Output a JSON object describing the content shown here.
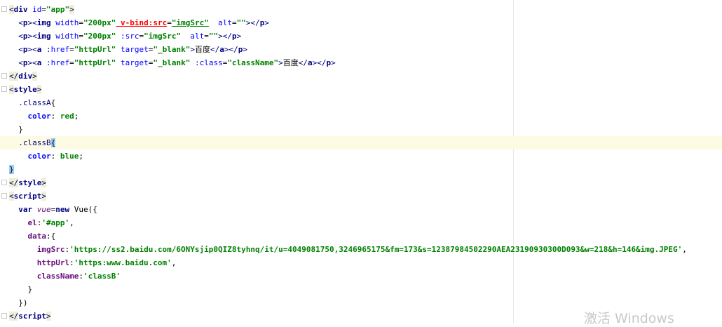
{
  "editor": {
    "lines": [
      {
        "tokens": [
          [
            "t-ptag tagbox",
            "<"
          ],
          [
            "t-tag",
            "div"
          ],
          [
            "t-attr",
            " id"
          ],
          [
            "t-punct",
            "="
          ],
          [
            "t-val",
            "\"app\""
          ],
          [
            "t-ptag tagbox",
            ">"
          ]
        ]
      },
      {
        "tokens": [
          [
            "t-ptag",
            "  <"
          ],
          [
            "t-tag",
            "p"
          ],
          [
            "t-ptag",
            "><"
          ],
          [
            "t-tag",
            "img"
          ],
          [
            "t-attr",
            " width"
          ],
          [
            "t-punct",
            "="
          ],
          [
            "t-val",
            "\"200px\""
          ],
          [
            "t-err",
            " v-bind"
          ],
          [
            "t-err",
            ":src"
          ],
          [
            "t-punct",
            "="
          ],
          [
            "t-val t-under",
            "\"imgSrc\""
          ],
          [
            "t-attr",
            "  alt"
          ],
          [
            "t-punct",
            "="
          ],
          [
            "t-val",
            "\"\""
          ],
          [
            "t-ptag",
            "></"
          ],
          [
            "t-tag",
            "p"
          ],
          [
            "t-ptag",
            ">"
          ]
        ]
      },
      {
        "tokens": [
          [
            "t-ptag",
            "  <"
          ],
          [
            "t-tag",
            "p"
          ],
          [
            "t-ptag",
            "><"
          ],
          [
            "t-tag",
            "img"
          ],
          [
            "t-attr",
            " width"
          ],
          [
            "t-punct",
            "="
          ],
          [
            "t-val",
            "\"200px\""
          ],
          [
            "t-attr",
            " :src"
          ],
          [
            "t-punct",
            "="
          ],
          [
            "t-val",
            "\"imgSrc\""
          ],
          [
            "t-attr",
            "  alt"
          ],
          [
            "t-punct",
            "="
          ],
          [
            "t-val",
            "\"\""
          ],
          [
            "t-ptag",
            "></"
          ],
          [
            "t-tag",
            "p"
          ],
          [
            "t-ptag",
            ">"
          ]
        ]
      },
      {
        "tokens": [
          [
            "t-ptag",
            "  <"
          ],
          [
            "t-tag",
            "p"
          ],
          [
            "t-ptag",
            "><"
          ],
          [
            "t-tag",
            "a"
          ],
          [
            "t-attr",
            " :href"
          ],
          [
            "t-punct",
            "="
          ],
          [
            "t-val",
            "\"httpUrl\""
          ],
          [
            "t-attr",
            " target"
          ],
          [
            "t-punct",
            "="
          ],
          [
            "t-val",
            "\"_blank\""
          ],
          [
            "t-ptag",
            ">"
          ],
          [
            "t-txt",
            "百度"
          ],
          [
            "t-ptag",
            "</"
          ],
          [
            "t-tag",
            "a"
          ],
          [
            "t-ptag",
            "></"
          ],
          [
            "t-tag",
            "p"
          ],
          [
            "t-ptag",
            ">"
          ]
        ]
      },
      {
        "tokens": [
          [
            "t-ptag",
            "  <"
          ],
          [
            "t-tag",
            "p"
          ],
          [
            "t-ptag",
            "><"
          ],
          [
            "t-tag",
            "a"
          ],
          [
            "t-attr",
            " :href"
          ],
          [
            "t-punct",
            "="
          ],
          [
            "t-val",
            "\"httpUrl\""
          ],
          [
            "t-attr",
            " target"
          ],
          [
            "t-punct",
            "="
          ],
          [
            "t-val",
            "\"_blank\""
          ],
          [
            "t-attr",
            " :class"
          ],
          [
            "t-punct",
            "="
          ],
          [
            "t-val",
            "\"className\""
          ],
          [
            "t-ptag",
            ">"
          ],
          [
            "t-txt",
            "百度"
          ],
          [
            "t-ptag",
            "</"
          ],
          [
            "t-tag",
            "a"
          ],
          [
            "t-ptag",
            "></"
          ],
          [
            "t-tag",
            "p"
          ],
          [
            "t-ptag",
            ">"
          ]
        ]
      },
      {
        "tokens": [
          [
            "t-ptag tagbox",
            "</"
          ],
          [
            "t-tag",
            "div"
          ],
          [
            "t-ptag tagbox",
            ">"
          ]
        ]
      },
      {
        "tokens": [
          [
            "t-ptag tagbox",
            "<"
          ],
          [
            "t-tag",
            "style"
          ],
          [
            "t-ptag tagbox",
            ">"
          ]
        ]
      },
      {
        "tokens": [
          [
            "t-sel",
            "  .classA"
          ],
          [
            "t-punct",
            "{"
          ]
        ]
      },
      {
        "tokens": [
          [
            "t-cssprop",
            "    color"
          ],
          [
            "t-punct",
            ": "
          ],
          [
            "t-cssval",
            "red"
          ],
          [
            "t-punct",
            ";"
          ]
        ]
      },
      {
        "tokens": [
          [
            "t-punct",
            "  }"
          ]
        ]
      },
      {
        "tokens": [
          [
            "t-sel",
            "  .classB"
          ],
          [
            "t-punct brace-hl",
            "{"
          ]
        ],
        "highlight": true
      },
      {
        "tokens": [
          [
            "t-cssprop",
            "    color"
          ],
          [
            "t-punct",
            ": "
          ],
          [
            "t-cssval",
            "blue"
          ],
          [
            "t-punct",
            ";"
          ]
        ]
      },
      {
        "tokens": [
          [
            "t-punct brace-hl",
            "}"
          ]
        ]
      },
      {
        "tokens": [
          [
            "t-ptag tagbox",
            "</"
          ],
          [
            "t-tag",
            "style"
          ],
          [
            "t-ptag tagbox",
            ">"
          ]
        ]
      },
      {
        "tokens": [
          [
            "t-ptag tagbox",
            "<"
          ],
          [
            "t-tag",
            "script"
          ],
          [
            "t-ptag tagbox",
            ">"
          ]
        ]
      },
      {
        "tokens": [
          [
            "t-kw",
            "  var "
          ],
          [
            "t-var",
            "vue"
          ],
          [
            "t-punct",
            "="
          ],
          [
            "t-kw",
            "new "
          ],
          [
            "t-punct",
            "Vue({"
          ]
        ]
      },
      {
        "tokens": [
          [
            "t-prop",
            "    el"
          ],
          [
            "t-punct",
            ":"
          ],
          [
            "t-str",
            "'#app'"
          ],
          [
            "t-punct",
            ","
          ]
        ]
      },
      {
        "tokens": [
          [
            "t-prop",
            "    data"
          ],
          [
            "t-punct",
            ":{"
          ]
        ]
      },
      {
        "tokens": [
          [
            "t-prop",
            "      imgSrc"
          ],
          [
            "t-punct",
            ":"
          ],
          [
            "t-str",
            "'https://ss2.baidu.com/6ONYsjip0QIZ8tyhnq/it/u=4049081750,3246965175&fm=173&s=12387984502290AEA23190930300D093&w=218&h=146&img.JPEG'"
          ],
          [
            "t-punct",
            ","
          ]
        ]
      },
      {
        "tokens": [
          [
            "t-prop",
            "      httpUrl"
          ],
          [
            "t-punct",
            ":"
          ],
          [
            "t-str",
            "'https:www.baidu.com'"
          ],
          [
            "t-punct",
            ","
          ]
        ]
      },
      {
        "tokens": [
          [
            "t-prop",
            "      className"
          ],
          [
            "t-punct",
            ":"
          ],
          [
            "t-str",
            "'classB'"
          ]
        ]
      },
      {
        "tokens": [
          [
            "t-punct",
            "    }"
          ]
        ]
      },
      {
        "tokens": [
          [
            "t-punct",
            "  })"
          ]
        ]
      },
      {
        "tokens": [
          [
            "t-ptag tagbox",
            "</"
          ],
          [
            "t-tag",
            "script"
          ],
          [
            "t-ptag tagbox",
            ">"
          ]
        ]
      }
    ]
  },
  "watermark": "激活 Windows"
}
